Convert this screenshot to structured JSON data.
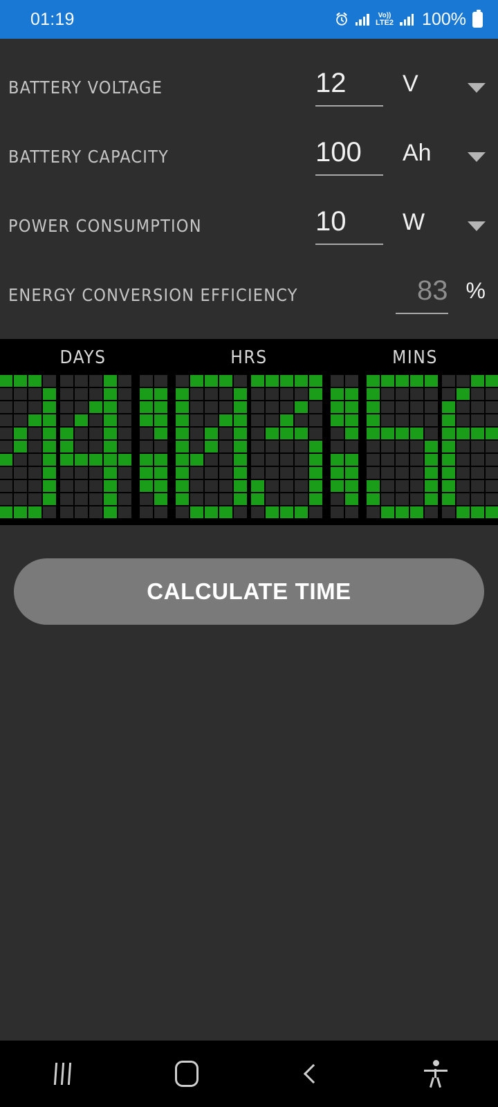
{
  "status_bar": {
    "clock": "01:19",
    "battery_percent": "100%",
    "volte_top": "Vo))",
    "volte_bottom": "LTE2",
    "icons": [
      "alarm-icon",
      "signal-bars-icon",
      "volte-icon",
      "signal-bars-icon",
      "battery-icon"
    ],
    "background_color": "#1878d4"
  },
  "form": {
    "rows": [
      {
        "label": "BATTERY VOLTAGE",
        "value": "12",
        "unit": "V",
        "has_dropdown": true,
        "dim": false
      },
      {
        "label": "BATTERY CAPACITY",
        "value": "100",
        "unit": "Ah",
        "has_dropdown": true,
        "dim": false
      },
      {
        "label": "POWER CONSUMPTION",
        "value": "10",
        "unit": "W",
        "has_dropdown": true,
        "dim": false
      },
      {
        "label": "ENERGY CONVERSION EFFICIENCY",
        "value": "83",
        "unit": "%",
        "has_dropdown": false,
        "dim": true
      }
    ]
  },
  "display": {
    "headers": [
      "DAYS",
      "HRS",
      "MINS"
    ],
    "days": "04",
    "hours": "03",
    "minutes": "56",
    "readout": "04:03:56",
    "on_color": "#1a9e1a",
    "off_color": "#2a2a2a",
    "background_color": "#000000"
  },
  "actions": {
    "calculate_label": "CALCULATE TIME",
    "calculate_color": "#7a7a7a"
  },
  "navbar": {
    "items": [
      "recents-icon",
      "home-icon",
      "back-icon",
      "accessibility-icon"
    ]
  }
}
